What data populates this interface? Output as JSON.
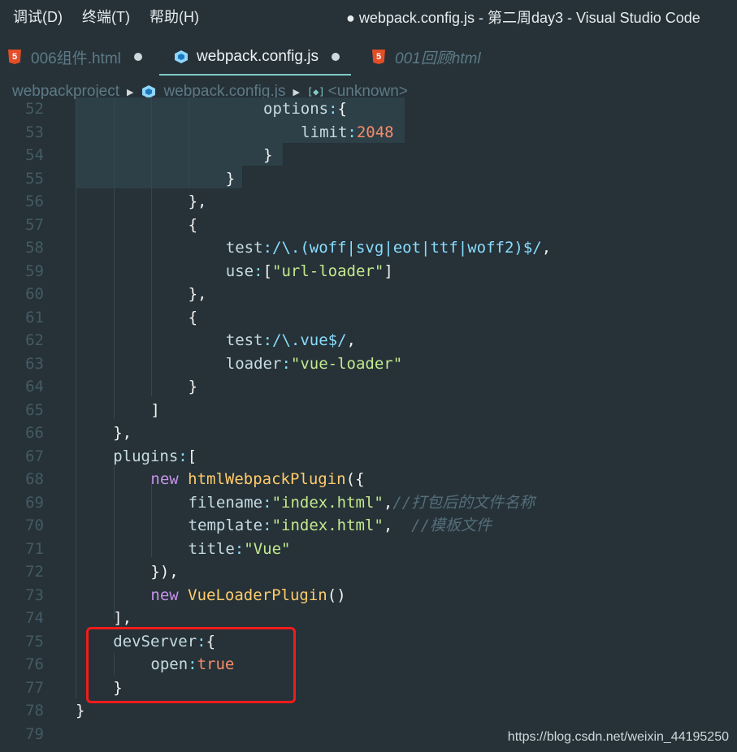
{
  "menubar": {
    "items": [
      "调试(D)",
      "终端(T)",
      "帮助(H)"
    ],
    "window_title": "● webpack.config.js - 第二周day3 - Visual Studio Code"
  },
  "tabs": [
    {
      "label": "006组件.html",
      "icon": "html5-icon",
      "modified": true
    },
    {
      "label": "webpack.config.js",
      "icon": "webpack-icon",
      "modified": true,
      "active": true
    },
    {
      "label": "001回顾html",
      "icon": "html5-icon",
      "italic": true
    }
  ],
  "breadcrumb": {
    "project": "webpackproject",
    "file": "webpack.config.js",
    "symbol": "<unknown>"
  },
  "colors": {
    "background": "#263238",
    "accent": "#80cbc4",
    "highlight_box": "#f21b1b"
  },
  "code": {
    "lines": [
      {
        "n": "52",
        "t": [
          [
            "k",
            "options"
          ],
          [
            "p",
            ":"
          ],
          [
            "b",
            "{"
          ]
        ]
      },
      {
        "n": "53",
        "t": [
          [
            "k",
            "limit"
          ],
          [
            "p",
            ":"
          ],
          [
            "n",
            "2048"
          ]
        ]
      },
      {
        "n": "54",
        "t": [
          [
            "b",
            "}"
          ]
        ]
      },
      {
        "n": "55",
        "t": [
          [
            "b",
            "}"
          ]
        ]
      },
      {
        "n": "56",
        "t": [
          [
            "b",
            "},"
          ]
        ]
      },
      {
        "n": "57",
        "t": [
          [
            "b",
            "{"
          ]
        ]
      },
      {
        "n": "58",
        "t": [
          [
            "k",
            "test"
          ],
          [
            "p",
            ":"
          ],
          [
            "r",
            "/\\.(woff|svg|eot|ttf|woff2)$/"
          ],
          [
            "b",
            ","
          ]
        ]
      },
      {
        "n": "59",
        "t": [
          [
            "k",
            "use"
          ],
          [
            "p",
            ":"
          ],
          [
            "b",
            "["
          ],
          [
            "s",
            "\"url-loader\""
          ],
          [
            "b",
            "]"
          ]
        ]
      },
      {
        "n": "60",
        "t": [
          [
            "b",
            "},"
          ]
        ]
      },
      {
        "n": "61",
        "t": [
          [
            "b",
            "{"
          ]
        ]
      },
      {
        "n": "62",
        "t": [
          [
            "k",
            "test"
          ],
          [
            "p",
            ":"
          ],
          [
            "r",
            "/\\.vue$/"
          ],
          [
            "b",
            ","
          ]
        ]
      },
      {
        "n": "63",
        "t": [
          [
            "k",
            "loader"
          ],
          [
            "p",
            ":"
          ],
          [
            "s",
            "\"vue-loader\""
          ]
        ]
      },
      {
        "n": "64",
        "t": [
          [
            "b",
            "}"
          ]
        ]
      },
      {
        "n": "65",
        "t": [
          [
            "b",
            "]"
          ]
        ]
      },
      {
        "n": "66",
        "t": [
          [
            "b",
            "},"
          ]
        ]
      },
      {
        "n": "67",
        "t": [
          [
            "k",
            "plugins"
          ],
          [
            "p",
            ":"
          ],
          [
            "b",
            "["
          ]
        ]
      },
      {
        "n": "68",
        "t": [
          [
            "kw",
            "new "
          ],
          [
            "fn",
            "htmlWebpackPlugin"
          ],
          [
            "b",
            "({"
          ]
        ]
      },
      {
        "n": "69",
        "t": [
          [
            "k",
            "filename"
          ],
          [
            "p",
            ":"
          ],
          [
            "s",
            "\"index.html\""
          ],
          [
            "b",
            ","
          ],
          [
            "c",
            "//打包后的文件名称"
          ]
        ]
      },
      {
        "n": "70",
        "t": [
          [
            "k",
            "template"
          ],
          [
            "p",
            ":"
          ],
          [
            "s",
            "\"index.html\""
          ],
          [
            "b",
            ",  "
          ],
          [
            "c",
            "//模板文件"
          ]
        ]
      },
      {
        "n": "71",
        "t": [
          [
            "k",
            "title"
          ],
          [
            "p",
            ":"
          ],
          [
            "s",
            "\"Vue\""
          ]
        ]
      },
      {
        "n": "72",
        "t": [
          [
            "b",
            "}),"
          ]
        ]
      },
      {
        "n": "73",
        "t": [
          [
            "kw",
            "new "
          ],
          [
            "fn",
            "VueLoaderPlugin"
          ],
          [
            "b",
            "()"
          ]
        ]
      },
      {
        "n": "74",
        "t": [
          [
            "b",
            "],"
          ]
        ]
      },
      {
        "n": "75",
        "t": [
          [
            "k",
            "devServer"
          ],
          [
            "p",
            ":"
          ],
          [
            "b",
            "{"
          ]
        ]
      },
      {
        "n": "76",
        "t": [
          [
            "k",
            "open"
          ],
          [
            "p",
            ":"
          ],
          [
            "n",
            "true"
          ]
        ]
      },
      {
        "n": "77",
        "t": [
          [
            "b",
            "}"
          ]
        ]
      },
      {
        "n": "78",
        "t": [
          [
            "b",
            "}"
          ]
        ]
      },
      {
        "n": "79",
        "t": []
      }
    ]
  },
  "watermark": "https://blog.csdn.net/weixin_44195250"
}
